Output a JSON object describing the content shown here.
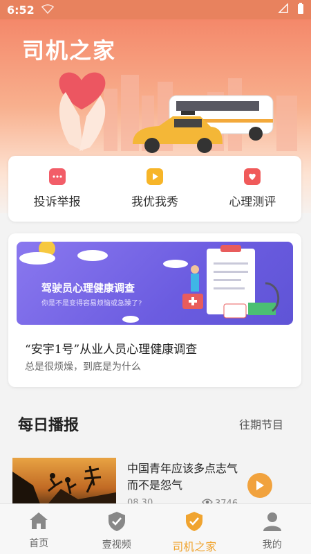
{
  "status_bar": {
    "time": "6:52"
  },
  "header": {
    "title": "司机之家"
  },
  "quick_actions": [
    {
      "label": "投诉举报",
      "icon": "chat-icon",
      "color": "#f25d68"
    },
    {
      "label": "我优我秀",
      "icon": "video-icon",
      "color": "#f7b528"
    },
    {
      "label": "心理测评",
      "icon": "heart-shield-icon",
      "color": "#f05a5a"
    }
  ],
  "survey": {
    "banner_title": "驾驶员心理健康调查",
    "banner_subtitle": "你是不是变得容易烦恼或急躁了?",
    "title": "“安宇1号”从业人员心理健康调查",
    "description": "总是很烦燥，到底是为什么"
  },
  "daily": {
    "title": "每日播报",
    "link": "往期节目",
    "items": [
      {
        "title": "中国青年应该多点志气而不是怨气",
        "date": "08.30",
        "views": "3746"
      }
    ]
  },
  "tabs": [
    {
      "label": "首页",
      "icon": "home-icon",
      "active": false
    },
    {
      "label": "壹视频",
      "icon": "shield-check-icon",
      "active": false
    },
    {
      "label": "司机之家",
      "icon": "shield-check-icon",
      "active": true
    },
    {
      "label": "我的",
      "icon": "user-icon",
      "active": false
    }
  ],
  "colors": {
    "accent": "#f0a430",
    "hero": "#f4886a",
    "banner": "#7a69ea"
  }
}
